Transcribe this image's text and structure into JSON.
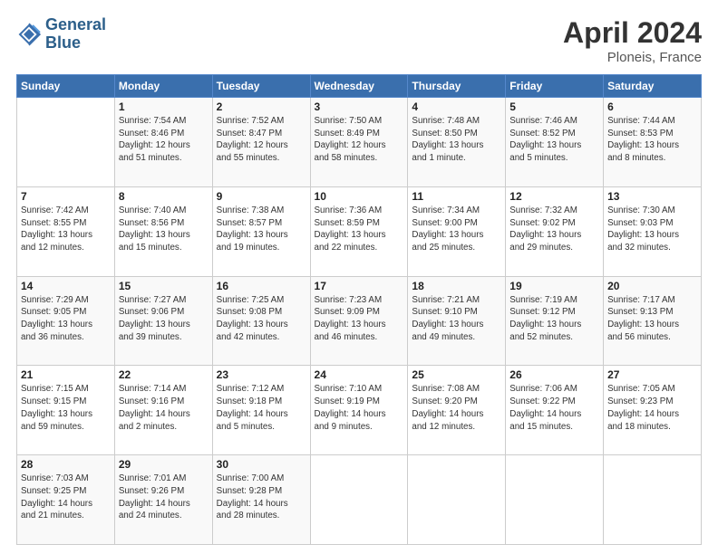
{
  "header": {
    "logo_line1": "General",
    "logo_line2": "Blue",
    "title": "April 2024",
    "location": "Ploneis, France"
  },
  "weekdays": [
    "Sunday",
    "Monday",
    "Tuesday",
    "Wednesday",
    "Thursday",
    "Friday",
    "Saturday"
  ],
  "weeks": [
    [
      {
        "day": "",
        "info": ""
      },
      {
        "day": "1",
        "info": "Sunrise: 7:54 AM\nSunset: 8:46 PM\nDaylight: 12 hours\nand 51 minutes."
      },
      {
        "day": "2",
        "info": "Sunrise: 7:52 AM\nSunset: 8:47 PM\nDaylight: 12 hours\nand 55 minutes."
      },
      {
        "day": "3",
        "info": "Sunrise: 7:50 AM\nSunset: 8:49 PM\nDaylight: 12 hours\nand 58 minutes."
      },
      {
        "day": "4",
        "info": "Sunrise: 7:48 AM\nSunset: 8:50 PM\nDaylight: 13 hours\nand 1 minute."
      },
      {
        "day": "5",
        "info": "Sunrise: 7:46 AM\nSunset: 8:52 PM\nDaylight: 13 hours\nand 5 minutes."
      },
      {
        "day": "6",
        "info": "Sunrise: 7:44 AM\nSunset: 8:53 PM\nDaylight: 13 hours\nand 8 minutes."
      }
    ],
    [
      {
        "day": "7",
        "info": "Sunrise: 7:42 AM\nSunset: 8:55 PM\nDaylight: 13 hours\nand 12 minutes."
      },
      {
        "day": "8",
        "info": "Sunrise: 7:40 AM\nSunset: 8:56 PM\nDaylight: 13 hours\nand 15 minutes."
      },
      {
        "day": "9",
        "info": "Sunrise: 7:38 AM\nSunset: 8:57 PM\nDaylight: 13 hours\nand 19 minutes."
      },
      {
        "day": "10",
        "info": "Sunrise: 7:36 AM\nSunset: 8:59 PM\nDaylight: 13 hours\nand 22 minutes."
      },
      {
        "day": "11",
        "info": "Sunrise: 7:34 AM\nSunset: 9:00 PM\nDaylight: 13 hours\nand 25 minutes."
      },
      {
        "day": "12",
        "info": "Sunrise: 7:32 AM\nSunset: 9:02 PM\nDaylight: 13 hours\nand 29 minutes."
      },
      {
        "day": "13",
        "info": "Sunrise: 7:30 AM\nSunset: 9:03 PM\nDaylight: 13 hours\nand 32 minutes."
      }
    ],
    [
      {
        "day": "14",
        "info": "Sunrise: 7:29 AM\nSunset: 9:05 PM\nDaylight: 13 hours\nand 36 minutes."
      },
      {
        "day": "15",
        "info": "Sunrise: 7:27 AM\nSunset: 9:06 PM\nDaylight: 13 hours\nand 39 minutes."
      },
      {
        "day": "16",
        "info": "Sunrise: 7:25 AM\nSunset: 9:08 PM\nDaylight: 13 hours\nand 42 minutes."
      },
      {
        "day": "17",
        "info": "Sunrise: 7:23 AM\nSunset: 9:09 PM\nDaylight: 13 hours\nand 46 minutes."
      },
      {
        "day": "18",
        "info": "Sunrise: 7:21 AM\nSunset: 9:10 PM\nDaylight: 13 hours\nand 49 minutes."
      },
      {
        "day": "19",
        "info": "Sunrise: 7:19 AM\nSunset: 9:12 PM\nDaylight: 13 hours\nand 52 minutes."
      },
      {
        "day": "20",
        "info": "Sunrise: 7:17 AM\nSunset: 9:13 PM\nDaylight: 13 hours\nand 56 minutes."
      }
    ],
    [
      {
        "day": "21",
        "info": "Sunrise: 7:15 AM\nSunset: 9:15 PM\nDaylight: 13 hours\nand 59 minutes."
      },
      {
        "day": "22",
        "info": "Sunrise: 7:14 AM\nSunset: 9:16 PM\nDaylight: 14 hours\nand 2 minutes."
      },
      {
        "day": "23",
        "info": "Sunrise: 7:12 AM\nSunset: 9:18 PM\nDaylight: 14 hours\nand 5 minutes."
      },
      {
        "day": "24",
        "info": "Sunrise: 7:10 AM\nSunset: 9:19 PM\nDaylight: 14 hours\nand 9 minutes."
      },
      {
        "day": "25",
        "info": "Sunrise: 7:08 AM\nSunset: 9:20 PM\nDaylight: 14 hours\nand 12 minutes."
      },
      {
        "day": "26",
        "info": "Sunrise: 7:06 AM\nSunset: 9:22 PM\nDaylight: 14 hours\nand 15 minutes."
      },
      {
        "day": "27",
        "info": "Sunrise: 7:05 AM\nSunset: 9:23 PM\nDaylight: 14 hours\nand 18 minutes."
      }
    ],
    [
      {
        "day": "28",
        "info": "Sunrise: 7:03 AM\nSunset: 9:25 PM\nDaylight: 14 hours\nand 21 minutes."
      },
      {
        "day": "29",
        "info": "Sunrise: 7:01 AM\nSunset: 9:26 PM\nDaylight: 14 hours\nand 24 minutes."
      },
      {
        "day": "30",
        "info": "Sunrise: 7:00 AM\nSunset: 9:28 PM\nDaylight: 14 hours\nand 28 minutes."
      },
      {
        "day": "",
        "info": ""
      },
      {
        "day": "",
        "info": ""
      },
      {
        "day": "",
        "info": ""
      },
      {
        "day": "",
        "info": ""
      }
    ]
  ]
}
